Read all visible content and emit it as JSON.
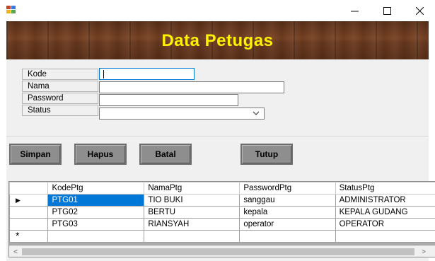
{
  "window": {
    "title": "",
    "icon": "app-form-icon",
    "controls": [
      "minimize-icon",
      "maximize-icon",
      "close-icon"
    ]
  },
  "banner": {
    "title": "Data Petugas",
    "title_color": "#fff200"
  },
  "form": {
    "fields": [
      {
        "label": "Kode",
        "value": ""
      },
      {
        "label": "Nama",
        "value": ""
      },
      {
        "label": "Password",
        "value": ""
      },
      {
        "label": "Status",
        "value": ""
      }
    ]
  },
  "buttons": {
    "save": "Simpan",
    "delete": "Hapus",
    "cancel": "Batal",
    "close": "Tutup"
  },
  "grid": {
    "columns": [
      "KodePtg",
      "NamaPtg",
      "PasswordPtg",
      "StatusPtg"
    ],
    "rows": [
      {
        "cells": [
          "PTG01",
          "TIO BUKI",
          "sanggau",
          "ADMINISTRATOR"
        ],
        "selected": true
      },
      {
        "cells": [
          "PTG02",
          "BERTU",
          "kepala",
          "KEPALA GUDANG"
        ],
        "selected": false
      },
      {
        "cells": [
          "PTG03",
          "RIANSYAH",
          "operator",
          "OPERATOR"
        ],
        "selected": false
      }
    ],
    "current_row_marker": "▶",
    "new_row_marker": "*",
    "selection_color": "#0078d7"
  }
}
